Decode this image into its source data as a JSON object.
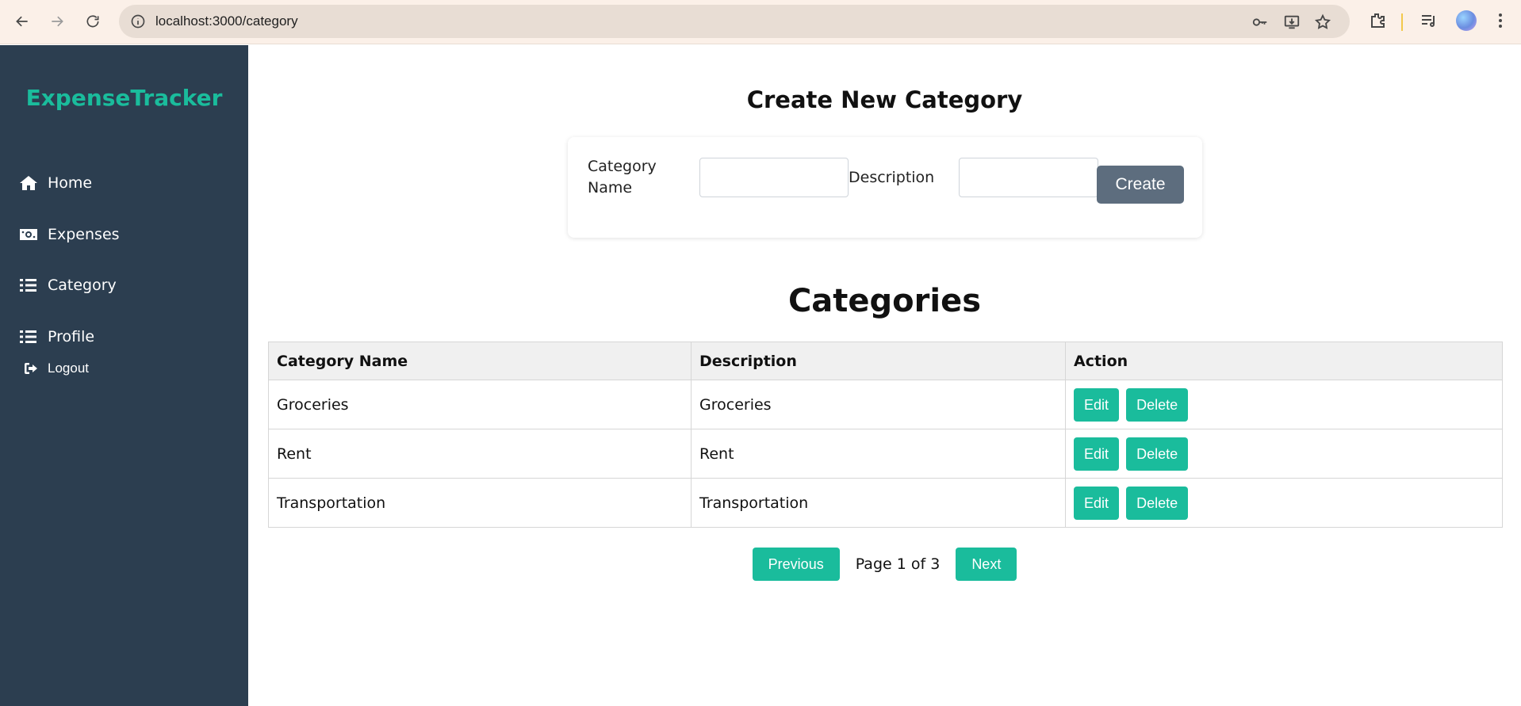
{
  "browser": {
    "url": "localhost:3000/category"
  },
  "sidebar": {
    "brand": "ExpenseTracker",
    "items": [
      {
        "label": "Home",
        "icon": "home-icon"
      },
      {
        "label": "Expenses",
        "icon": "money-bill-icon"
      },
      {
        "label": "Category",
        "icon": "list-icon"
      },
      {
        "label": "Profile",
        "icon": "list-icon"
      }
    ],
    "logout_label": "Logout",
    "background": "#2c3e50",
    "accent": "#1abc9c"
  },
  "create_form": {
    "title": "Create New Category",
    "name_label": "Category Name",
    "name_value": "",
    "description_label": "Description",
    "description_value": "",
    "submit_label": "Create"
  },
  "categories": {
    "title": "Categories",
    "columns": [
      "Category Name",
      "Description",
      "Action"
    ],
    "rows": [
      {
        "name": "Groceries",
        "description": "Groceries"
      },
      {
        "name": "Rent",
        "description": "Rent"
      },
      {
        "name": "Transportation",
        "description": "Transportation"
      }
    ],
    "edit_label": "Edit",
    "delete_label": "Delete"
  },
  "pagination": {
    "previous_label": "Previous",
    "page_text": "Page 1 of 3",
    "next_label": "Next"
  }
}
